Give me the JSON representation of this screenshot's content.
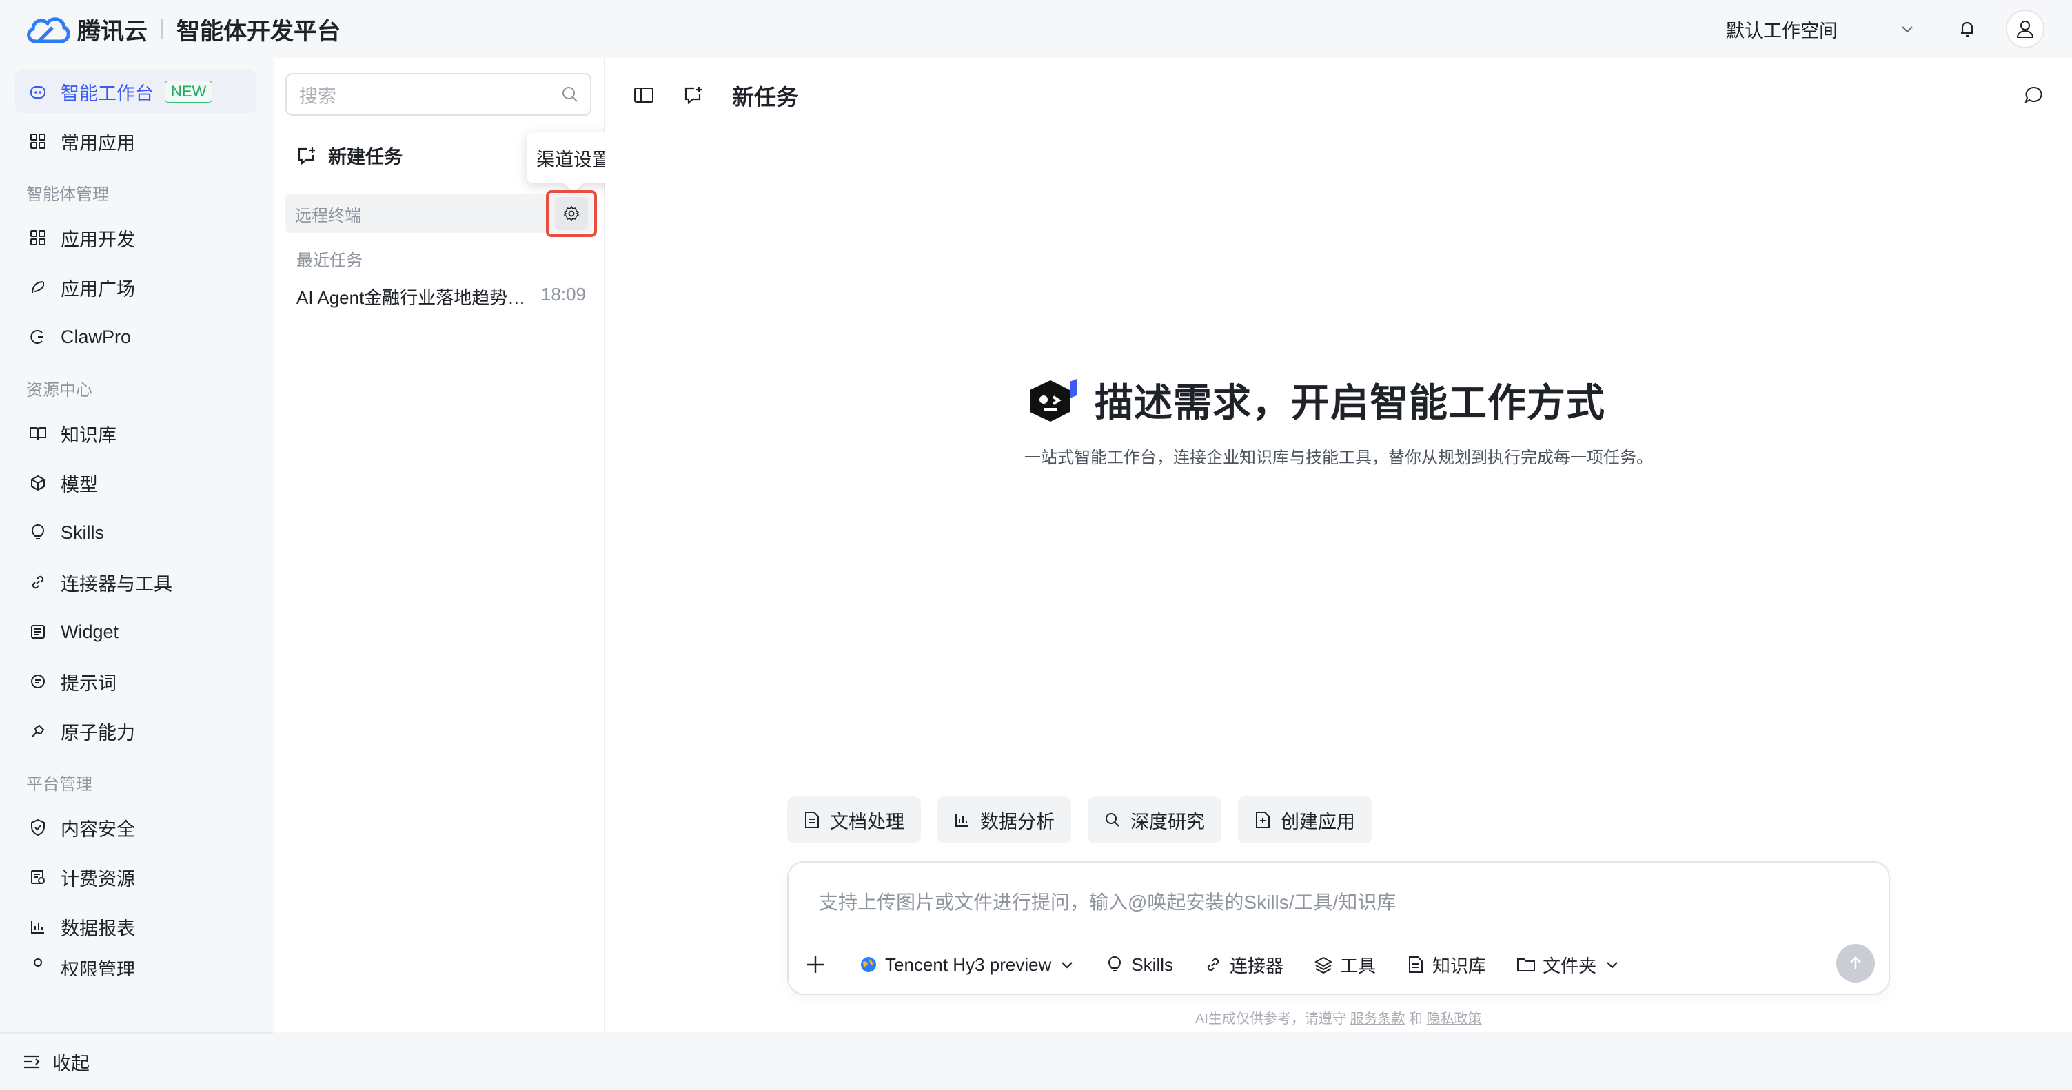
{
  "brand": {
    "logo_text": "腾讯云",
    "platform": "智能体开发平台"
  },
  "header": {
    "workspace": "默认工作空间"
  },
  "sidebar": {
    "items": [
      {
        "label": "智能工作台",
        "badge": "NEW",
        "icon": "robot-icon"
      },
      {
        "label": "常用应用",
        "icon": "apps-grid-icon"
      }
    ],
    "groups": [
      {
        "title": "智能体管理",
        "items": [
          {
            "label": "应用开发",
            "icon": "apps-grid-icon"
          },
          {
            "label": "应用广场",
            "icon": "square-icon"
          },
          {
            "label": "ClawPro",
            "icon": "claw-icon"
          }
        ]
      },
      {
        "title": "资源中心",
        "items": [
          {
            "label": "知识库",
            "icon": "book-icon"
          },
          {
            "label": "模型",
            "icon": "cube-icon"
          },
          {
            "label": "Skills",
            "icon": "bulb-icon"
          },
          {
            "label": "连接器与工具",
            "icon": "link-icon"
          },
          {
            "label": "Widget",
            "icon": "widget-icon"
          },
          {
            "label": "提示词",
            "icon": "prompt-icon"
          },
          {
            "label": "原子能力",
            "icon": "atom-icon"
          }
        ]
      },
      {
        "title": "平台管理",
        "items": [
          {
            "label": "内容安全",
            "icon": "shield-icon"
          },
          {
            "label": "计费资源",
            "icon": "billing-icon"
          },
          {
            "label": "数据报表",
            "icon": "bar-chart-icon"
          },
          {
            "label": "权限管理",
            "icon": "permission-icon"
          }
        ]
      }
    ],
    "collapse_label": "收起"
  },
  "panel": {
    "search_placeholder": "搜索",
    "new_task": "新建任务",
    "tooltip": "渠道设置",
    "remote_terminal": "远程终端",
    "recent_label": "最近任务",
    "recent_tasks": [
      {
        "title": "AI Agent金融行业落地趋势…",
        "time": "18:09"
      }
    ]
  },
  "main": {
    "title": "新任务",
    "hero_title": "描述需求，开启智能工作方式",
    "hero_subtitle": "一站式智能工作台，连接企业知识库与技能工具，替你从规划到执行完成每一项任务。",
    "chips": [
      "文档处理",
      "数据分析",
      "深度研究",
      "创建应用"
    ],
    "composer": {
      "placeholder": "支持上传图片或文件进行提问，输入@唤起安装的Skills/工具/知识库",
      "model": "Tencent Hy3 preview",
      "tools": [
        "Skills",
        "连接器",
        "工具",
        "知识库",
        "文件夹"
      ]
    },
    "footer": {
      "text": "AI生成仅供参考，请遵守",
      "terms": "服务条款",
      "and": "和",
      "privacy": "隐私政策"
    }
  },
  "colors": {
    "accent": "#3b5bf5",
    "new_badge": "#28a764",
    "highlight_border": "#e94e3c"
  }
}
